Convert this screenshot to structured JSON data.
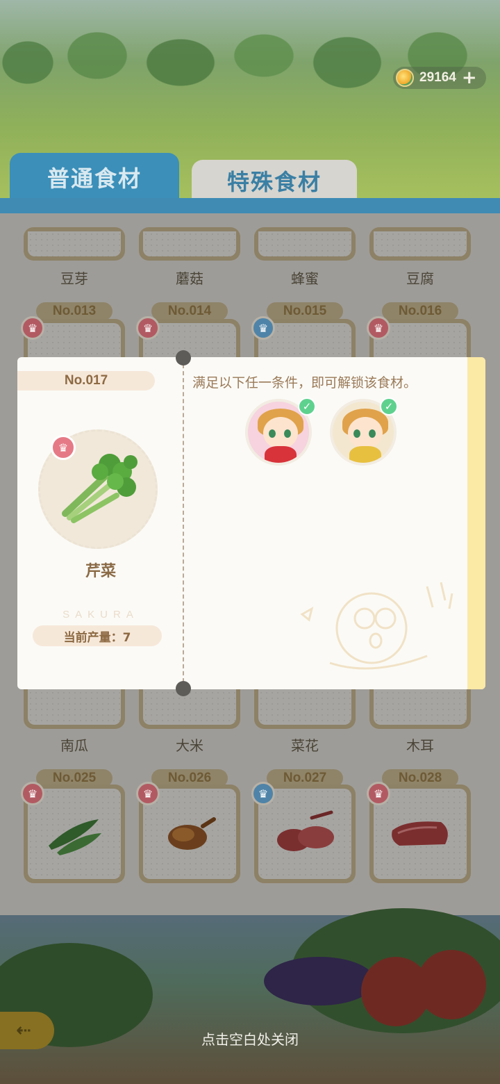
{
  "hud": {
    "currency_amount": "29164",
    "add_label": "+"
  },
  "tabs": [
    {
      "label": "普通食材"
    },
    {
      "label": "特殊食材"
    }
  ],
  "grid": {
    "row1_names": [
      "豆芽",
      "蘑菇",
      "蜂蜜",
      "豆腐"
    ],
    "row2_numbers": [
      "No.013",
      "No.014",
      "No.015",
      "No.016"
    ],
    "row3_names": [
      "南瓜",
      "大米",
      "菜花",
      "木耳"
    ],
    "row4_numbers": [
      "No.025",
      "No.026",
      "No.027",
      "No.028"
    ]
  },
  "modal": {
    "number": "No.017",
    "ingredient_name": "芹菜",
    "watermark": "SAKURA",
    "output_label": "当前产量：7",
    "condition": "满足以下任一条件，即可解锁该食材。"
  },
  "footer": {
    "close_hint": "点击空白处关闭"
  },
  "colors": {
    "tab_active": "#3b8fb9",
    "modal_bg": "#fbfaf6",
    "accent_brown": "#8d6a43",
    "check_green": "#5fd18e",
    "badge_red": "#e57a86"
  }
}
